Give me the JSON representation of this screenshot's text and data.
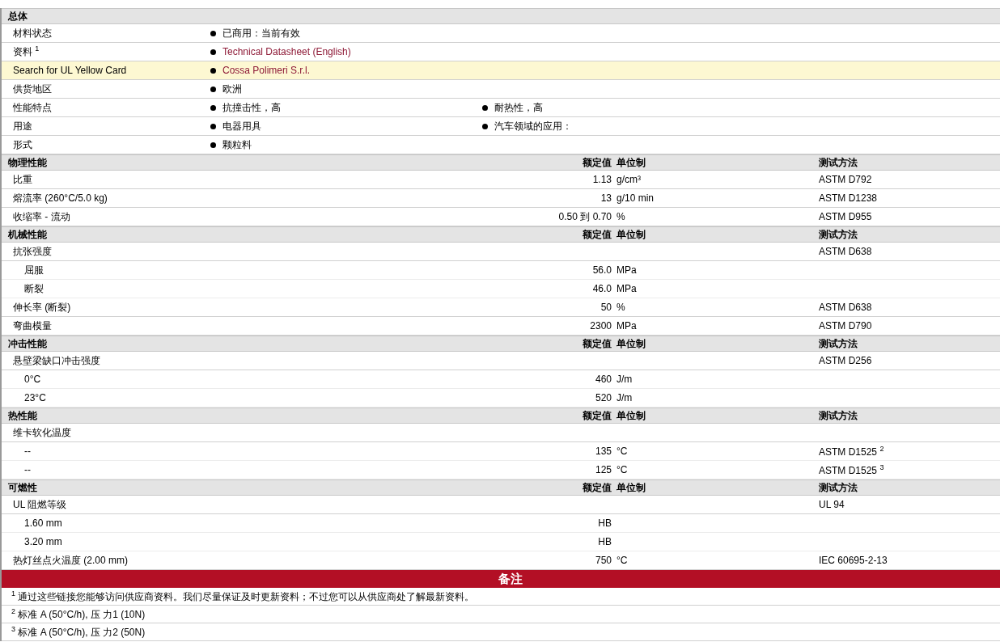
{
  "general": {
    "title": "总体",
    "rows": [
      {
        "label": "材料状态",
        "highlighted": false,
        "values": [
          {
            "kind": "text",
            "text": "已商用：当前有效"
          }
        ]
      },
      {
        "label": "资料 $^{1}$",
        "highlighted": false,
        "values": [
          {
            "kind": "link",
            "text": "Technical Datasheet (English)"
          }
        ]
      },
      {
        "label": "Search for UL Yellow Card",
        "highlighted": true,
        "values": [
          {
            "kind": "link",
            "text": "Cossa Polimeri S.r.l."
          }
        ]
      },
      {
        "label": "供货地区",
        "highlighted": false,
        "values": [
          {
            "kind": "text",
            "text": "欧洲"
          }
        ]
      },
      {
        "label": "性能特点",
        "highlighted": false,
        "values": [
          {
            "kind": "text",
            "text": "抗撞击性，高"
          },
          {
            "kind": "text",
            "text": "耐热性，高"
          }
        ]
      },
      {
        "label": "用途",
        "highlighted": false,
        "values": [
          {
            "kind": "text",
            "text": "电器用具"
          },
          {
            "kind": "text",
            "text": "汽车领域的应用："
          }
        ]
      },
      {
        "label": "形式",
        "highlighted": false,
        "values": [
          {
            "kind": "text",
            "text": "颗粒料"
          }
        ]
      }
    ]
  },
  "sections": [
    {
      "title": "物理性能",
      "value_header": "额定值",
      "unit_header": "单位制",
      "method_header": "测试方法",
      "rows": [
        {
          "name": "比重",
          "value": "1.13",
          "unit": "g/cm³",
          "method": "ASTM D792"
        },
        {
          "name": "熔流率  (260°C/5.0 kg)",
          "value": "13",
          "unit": "g/10 min",
          "method": "ASTM D1238"
        },
        {
          "name": "收缩率  - 流动",
          "value": "0.50 到  0.70",
          "unit": "%",
          "method": "ASTM D955"
        }
      ]
    },
    {
      "title": "机械性能",
      "value_header": "额定值",
      "unit_header": "单位制",
      "method_header": "测试方法",
      "rows": [
        {
          "name": "抗张强度",
          "method": "ASTM D638",
          "children": [
            {
              "name": "屈服",
              "value": "56.0",
              "unit": "MPa"
            },
            {
              "name": "断裂",
              "value": "46.0",
              "unit": "MPa"
            }
          ]
        },
        {
          "name": "伸长率  (断裂)",
          "value": "50",
          "unit": "%",
          "method": "ASTM D638"
        },
        {
          "name": "弯曲模量",
          "value": "2300",
          "unit": "MPa",
          "method": "ASTM D790"
        }
      ]
    },
    {
      "title": "冲击性能",
      "value_header": "额定值",
      "unit_header": "单位制",
      "method_header": "测试方法",
      "rows": [
        {
          "name": "悬壁梁缺口冲击强度",
          "method": "ASTM D256",
          "children": [
            {
              "name": "0°C",
              "value": "460",
              "unit": "J/m"
            },
            {
              "name": "23°C",
              "value": "520",
              "unit": "J/m"
            }
          ]
        }
      ]
    },
    {
      "title": "热性能",
      "value_header": "额定值",
      "unit_header": "单位制",
      "method_header": "测试方法",
      "rows": [
        {
          "name": "维卡软化温度",
          "children": [
            {
              "name": "--",
              "value": "135",
              "unit": "°C",
              "method": "ASTM D1525 $^{2}$"
            },
            {
              "name": "--",
              "value": "125",
              "unit": "°C",
              "method": "ASTM D1525 $^{3}$"
            }
          ]
        }
      ]
    },
    {
      "title": "可燃性",
      "value_header": "额定值",
      "unit_header": "单位制",
      "method_header": "测试方法",
      "rows": [
        {
          "name": "UL 阻燃等级",
          "method": "UL 94",
          "children": [
            {
              "name": "1.60 mm",
              "value": "HB"
            },
            {
              "name": "3.20 mm",
              "value": "HB"
            }
          ]
        },
        {
          "name": "热灯丝点火温度  (2.00 mm)",
          "value": "750",
          "unit": "°C",
          "method": "IEC 60695-2-13"
        }
      ]
    }
  ],
  "notes": {
    "title": "备注",
    "items": [
      "$^{1}$ 通过这些链接您能够访问供应商资料。我们尽量保证及时更新资料；不过您可以从供应商处了解最新资料。",
      "$^{2}$ 标准  A (50°C/h), 压  力1 (10N)",
      "$^{3}$ 标准  A (50°C/h), 压  力2 (50N)"
    ]
  }
}
